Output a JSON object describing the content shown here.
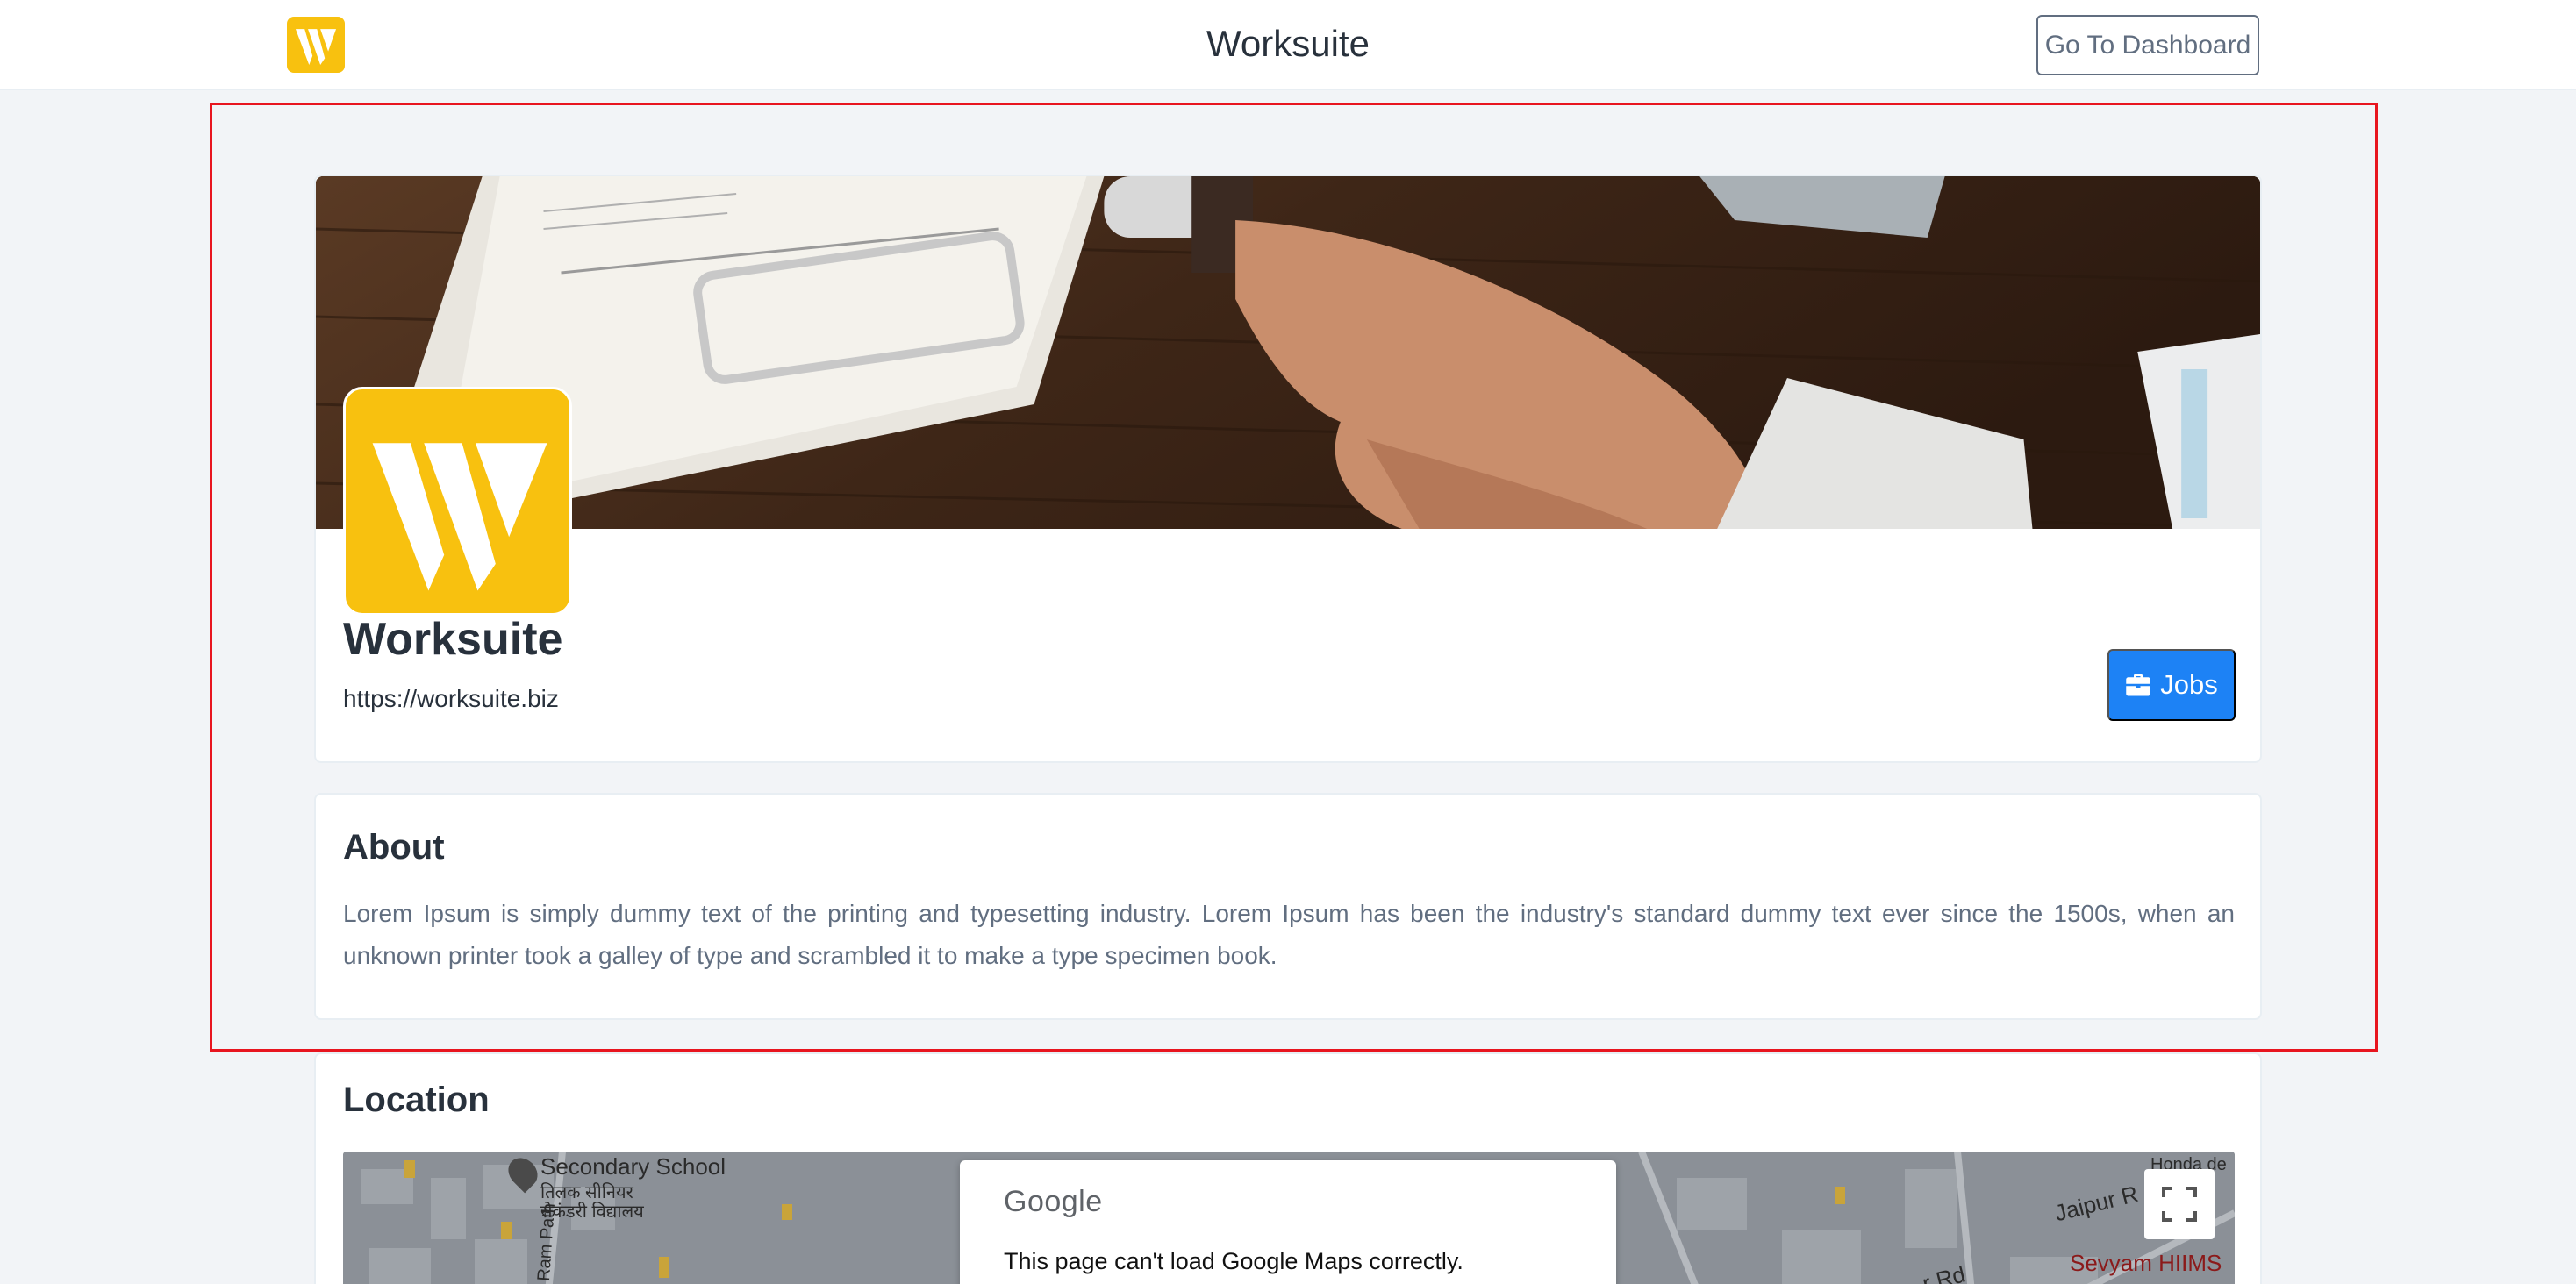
{
  "header": {
    "app_title": "Worksuite",
    "dashboard_button": "Go To Dashboard",
    "logo_icon": "worksuite-logo"
  },
  "company": {
    "name": "Worksuite",
    "website": "https://worksuite.biz",
    "jobs_button": "Jobs",
    "jobs_icon": "briefcase-icon",
    "cover_image": "handshake-contract-photo",
    "brand_color": "#f8c10f",
    "primary_color": "#1d82f5"
  },
  "about": {
    "title": "About",
    "text": "Lorem Ipsum is simply dummy text of the printing and typesetting industry. Lorem Ipsum has been the industry's standard dummy text ever since the 1500s, when an unknown printer took a galley of type and scrambled it to make a type specimen book."
  },
  "location": {
    "title": "Location",
    "map": {
      "labels": {
        "secondary_school": "Secondary School",
        "school_hindi_1": "तिलक सीनियर",
        "school_hindi_2": "सेकंडरी विद्यालय",
        "shri_ram_path": "Shri Ram Path",
        "jaipur_rd": "Jaipur R",
        "r_rd": "r Rd",
        "sevyam": "Sevyam HIIMS",
        "honda": "Honda de"
      },
      "provider": "Google",
      "error_message": "This page can't load Google Maps correctly.",
      "fullscreen_icon": "fullscreen-icon"
    }
  }
}
